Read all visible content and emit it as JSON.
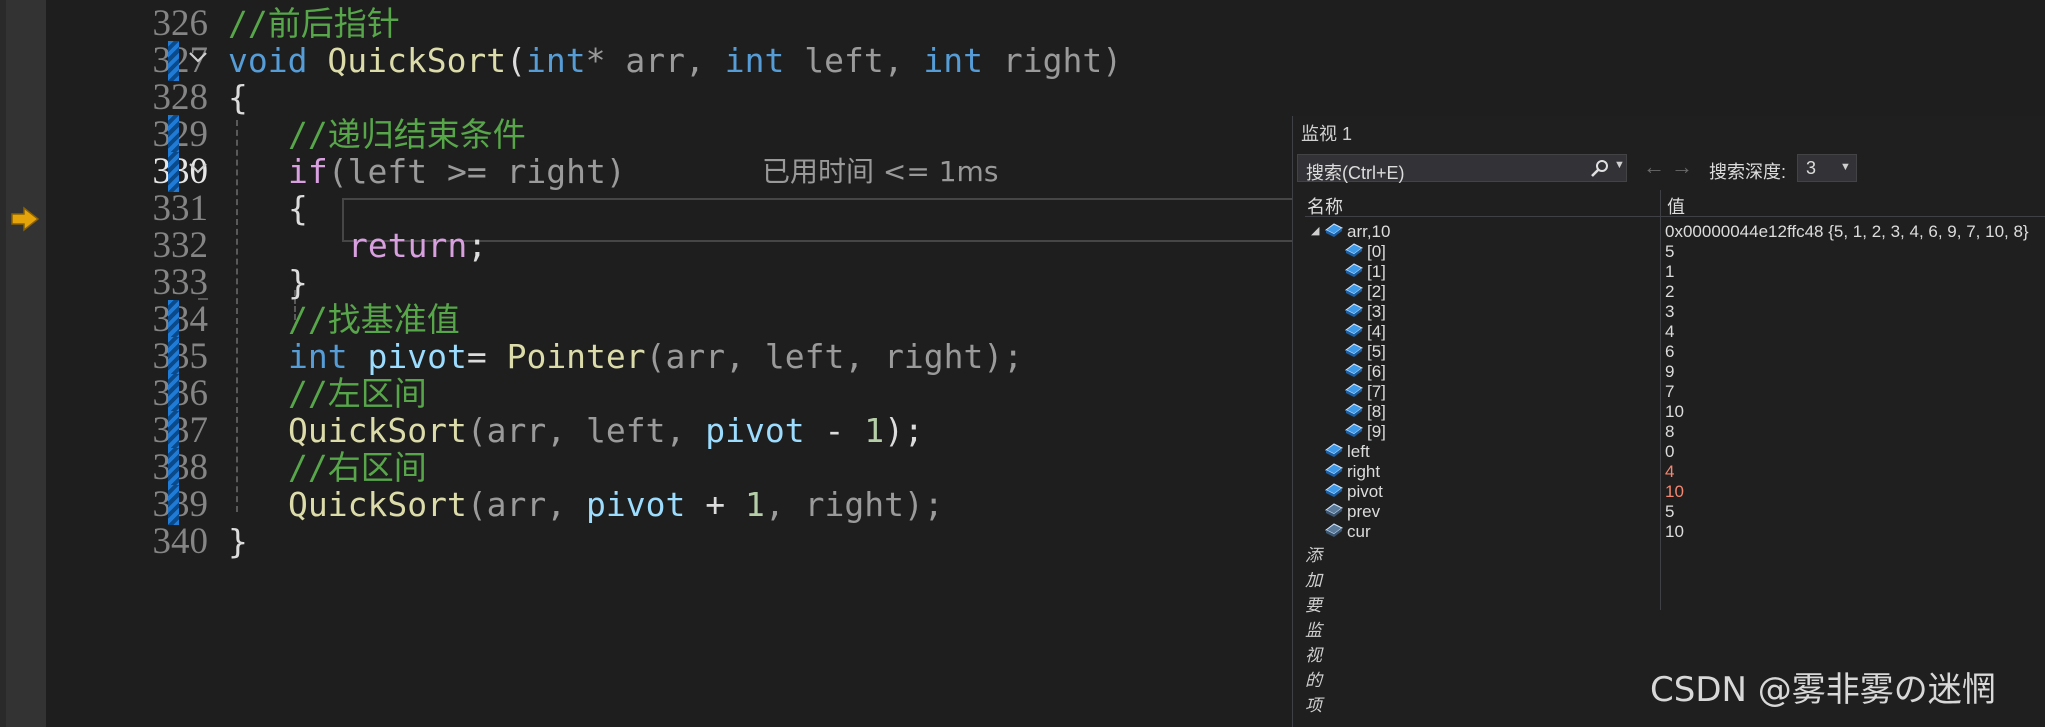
{
  "editor": {
    "lines": [
      {
        "num": "326"
      },
      {
        "num": "327"
      },
      {
        "num": "328"
      },
      {
        "num": "329"
      },
      {
        "num": "330"
      },
      {
        "num": "331"
      },
      {
        "num": "332"
      },
      {
        "num": "333"
      },
      {
        "num": "334"
      },
      {
        "num": "335"
      },
      {
        "num": "336"
      },
      {
        "num": "337"
      },
      {
        "num": "338"
      },
      {
        "num": "339"
      },
      {
        "num": "340"
      }
    ],
    "code": {
      "l326_comment": "//前后指针",
      "l327_void": "void",
      "l327_fn": "QuickSort",
      "l327_open": "(",
      "l327_int1": "int",
      "l327_p1": "* arr, ",
      "l327_int2": "int",
      "l327_p2": " left, ",
      "l327_int3": "int",
      "l327_p3": " right)",
      "l328": "{",
      "l329_comment": "//递归结束条件",
      "l330_if": "if",
      "l330_rest": "(left >= right)",
      "l331": "{",
      "l332_return": "return",
      "l332_semi": ";",
      "l333": "}",
      "l334_comment": "//找基准值",
      "l335_int": "int",
      "l335_var": " pivot",
      "l335_eq": "= ",
      "l335_fn": "Pointer",
      "l335_args": "(arr, left, right);",
      "l336_comment": "//左区间",
      "l337_fn": "QuickSort",
      "l337_a": "(arr, left, ",
      "l337_var": "pivot",
      "l337_b": " - ",
      "l337_num": "1",
      "l337_c": ");",
      "l338_comment": "//右区间",
      "l339_fn": "QuickSort",
      "l339_a": "(arr, ",
      "l339_var": "pivot",
      "l339_b": " + ",
      "l339_num": "1",
      "l339_c": ", right);",
      "l340": "}"
    },
    "perf_tip": "已用时间 <= 1ms"
  },
  "watch": {
    "title": "监视 1",
    "search_placeholder": "搜索(Ctrl+E)",
    "depth_label": "搜索深度:",
    "depth_value": "3",
    "col_name": "名称",
    "col_value": "值",
    "rows": [
      {
        "name": "arr,10",
        "value": "0x00000044e12ffc48 {5, 1, 2, 3, 4, 6, 9, 7, 10, 8}"
      },
      {
        "name": "[0]",
        "value": "5"
      },
      {
        "name": "[1]",
        "value": "1"
      },
      {
        "name": "[2]",
        "value": "2"
      },
      {
        "name": "[3]",
        "value": "3"
      },
      {
        "name": "[4]",
        "value": "4"
      },
      {
        "name": "[5]",
        "value": "6"
      },
      {
        "name": "[6]",
        "value": "9"
      },
      {
        "name": "[7]",
        "value": "7"
      },
      {
        "name": "[8]",
        "value": "10"
      },
      {
        "name": "[9]",
        "value": "8"
      },
      {
        "name": "left",
        "value": "0"
      },
      {
        "name": "right",
        "value": "4"
      },
      {
        "name": "pivot",
        "value": "10"
      },
      {
        "name": "prev",
        "value": "5"
      },
      {
        "name": "cur",
        "value": "10"
      }
    ],
    "add_item": "添加要监视的项"
  },
  "watermark": "CSDN @雾非雾の迷惘",
  "colors": {
    "keyword": "#569cd6",
    "control": "#d8a0df",
    "function": "#dcdcaa",
    "variable": "#9cdcfe",
    "comment": "#57a64a",
    "changed_value": "#f48771",
    "exec_arrow": "#e5a50a"
  },
  "icons": {
    "exec_arrow": "execution-pointer-icon",
    "fold": "chevron-down-icon",
    "search": "search-icon",
    "watch_item": "variable-cube-icon"
  }
}
